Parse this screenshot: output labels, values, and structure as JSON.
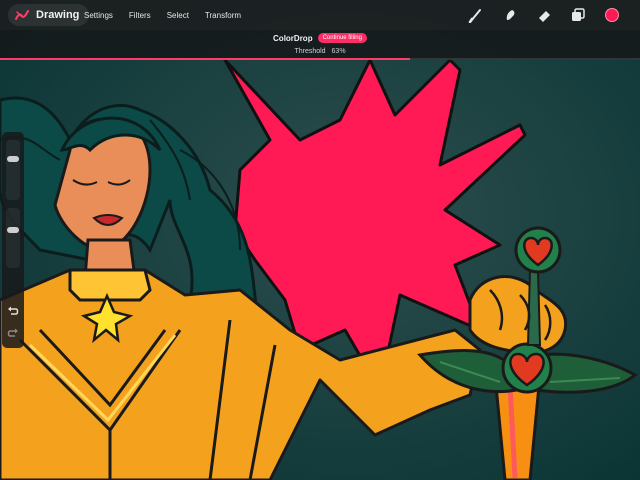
{
  "app": {
    "title": "Drawing",
    "logo_icon": "brush-stroke-icon"
  },
  "menu": [
    "Settings",
    "Filters",
    "Select",
    "Transform"
  ],
  "tools": [
    {
      "name": "brush",
      "icon": "brush-icon"
    },
    {
      "name": "smudge",
      "icon": "smudge-icon"
    },
    {
      "name": "eraser",
      "icon": "eraser-icon"
    },
    {
      "name": "layers",
      "icon": "layers-icon"
    }
  ],
  "color": "#ff1a55",
  "colordrop": {
    "label": "ColorDrop",
    "continue_label": "Continue filling",
    "threshold_label": "Threshold",
    "threshold_value": "63%",
    "threshold_fraction": 0.64
  },
  "sidebar": {
    "brush_size_fraction": 0.3,
    "opacity_fraction": 0.35,
    "undo_icon": "undo-icon",
    "redo_icon": "redo-icon"
  }
}
